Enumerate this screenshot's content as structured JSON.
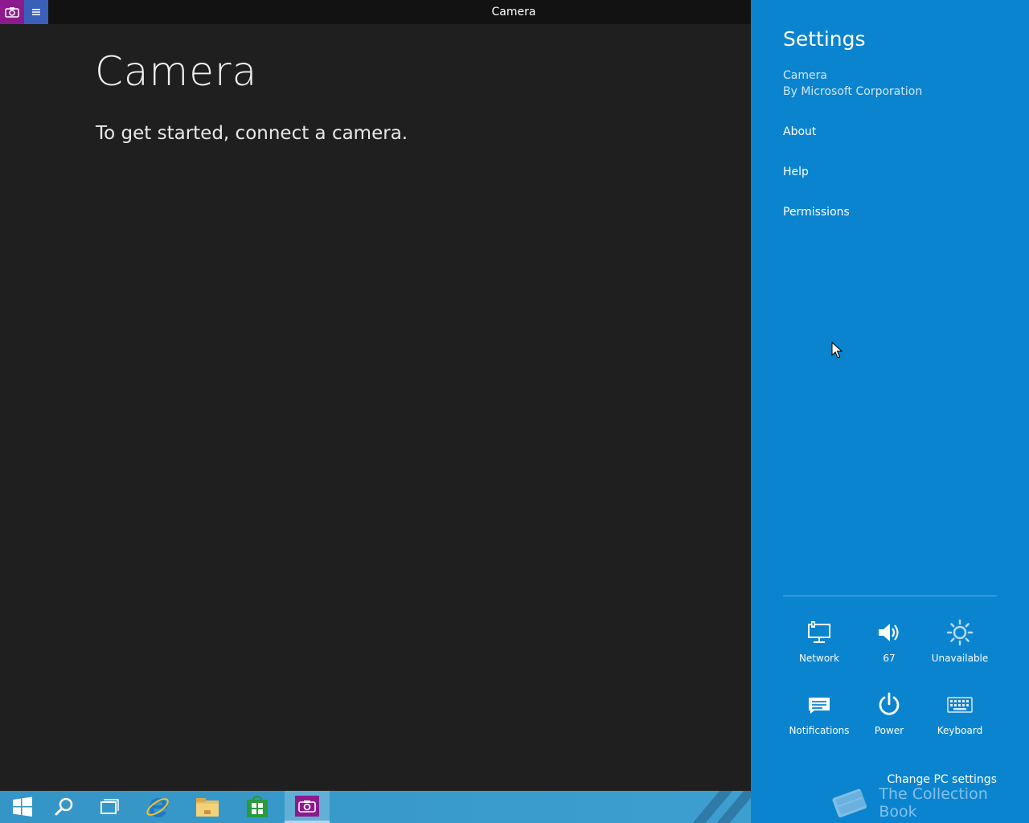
{
  "window": {
    "title": "Camera"
  },
  "app": {
    "heading": "Camera",
    "message": "To get started, connect a camera."
  },
  "charm": {
    "title": "Settings",
    "app_name": "Camera",
    "app_publisher": "By Microsoft Corporation",
    "links": [
      "About",
      "Help",
      "Permissions"
    ],
    "quick_settings": [
      {
        "icon": "network-icon",
        "label": "Network"
      },
      {
        "icon": "volume-icon",
        "label": "67"
      },
      {
        "icon": "brightness-icon",
        "label": "Unavailable"
      },
      {
        "icon": "notifications-icon",
        "label": "Notifications"
      },
      {
        "icon": "power-icon",
        "label": "Power"
      },
      {
        "icon": "keyboard-icon",
        "label": "Keyboard"
      }
    ],
    "change_pc_settings": "Change PC settings"
  },
  "taskbar": {
    "items": [
      "start-icon",
      "search-icon",
      "task-view-icon",
      "internet-explorer-icon",
      "file-explorer-icon",
      "store-icon",
      "camera-app-icon"
    ]
  },
  "watermark": {
    "text": "The Collection Book"
  },
  "colors": {
    "charm_bg": "#0b84d0",
    "app_bg": "#1f1f1f",
    "camera_accent": "#8c1a8e"
  }
}
